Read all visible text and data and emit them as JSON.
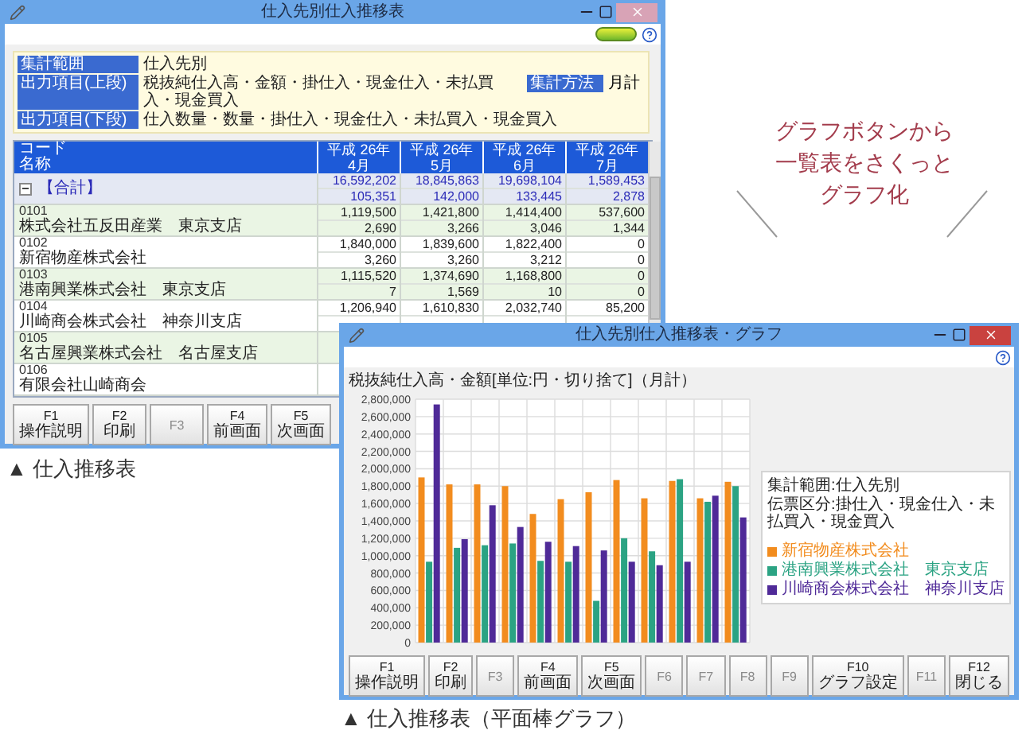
{
  "table_window": {
    "title": "仕入先別仕入推移表",
    "summary": [
      {
        "label": "集計範囲",
        "value": "仕入先別"
      },
      {
        "label": "出力項目(上段)",
        "value": "税抜純仕入高・金額・掛仕入・現金仕入・未払買入・現金買入",
        "method_label": "集計方法",
        "method_value": "月計"
      },
      {
        "label": "出力項目(下段)",
        "value": "仕入数量・数量・掛仕入・現金仕入・未払買入・現金買入"
      }
    ],
    "table": {
      "code_header": "コード",
      "name_header": "名称",
      "columns": [
        {
          "year": "平成 26年",
          "month": "4月"
        },
        {
          "year": "平成 26年",
          "month": "5月"
        },
        {
          "year": "平成 26年",
          "month": "6月"
        },
        {
          "year": "平成 26年",
          "month": "7月"
        }
      ],
      "rows": [
        {
          "kind": "total",
          "expanded": true,
          "name": "【合計】",
          "amounts": [
            "16,592,202",
            "18,845,863",
            "19,698,104",
            "1,589,453"
          ],
          "quantities": [
            "105,351",
            "142,000",
            "133,445",
            "2,878"
          ]
        },
        {
          "kind": "company",
          "code": "0101",
          "name": "株式会社五反田産業　東京支店",
          "amounts": [
            "1,119,500",
            "1,421,800",
            "1,414,400",
            "537,600"
          ],
          "quantities": [
            "2,690",
            "3,266",
            "3,046",
            "1,344"
          ]
        },
        {
          "kind": "company",
          "code": "0102",
          "name": "新宿物産株式会社",
          "amounts": [
            "1,840,000",
            "1,839,600",
            "1,822,400",
            "0"
          ],
          "quantities": [
            "3,260",
            "3,260",
            "3,212",
            "0"
          ]
        },
        {
          "kind": "company",
          "code": "0103",
          "name": "港南興業株式会社　東京支店",
          "amounts": [
            "1,115,520",
            "1,374,690",
            "1,168,800",
            "0"
          ],
          "quantities": [
            "7",
            "1,569",
            "10",
            "0"
          ]
        },
        {
          "kind": "company",
          "code": "0104",
          "name": "川崎商会株式会社　神奈川支店",
          "amounts": [
            "1,206,940",
            "1,610,830",
            "2,032,740",
            "85,200"
          ]
        },
        {
          "kind": "company",
          "code": "0105",
          "name": "名古屋興業株式会社　名古屋支店"
        },
        {
          "kind": "company",
          "code": "0106",
          "name": "有限会社山崎商会"
        }
      ]
    },
    "function_keys": [
      {
        "key": "F1",
        "label": "操作説明",
        "disabled": false
      },
      {
        "key": "F2",
        "label": "印刷",
        "disabled": false
      },
      {
        "key": "F3",
        "disabled": true
      },
      {
        "key": "F4",
        "label": "前画面",
        "disabled": false
      },
      {
        "key": "F5",
        "label": "次画面",
        "disabled": false
      }
    ],
    "caption": "▲ 仕入推移表"
  },
  "graph_window": {
    "title": "仕入先別仕入推移表・グラフ",
    "chart_data": {
      "type": "bar",
      "grid": true,
      "title": "税抜純仕入高・金額[単位:円・切り捨て]（月計）",
      "ylim": [
        0,
        2800000
      ],
      "yticks": [
        {
          "value": 0,
          "label": "0"
        },
        {
          "value": 200000,
          "label": "200,000"
        },
        {
          "value": 400000,
          "label": "400,000"
        },
        {
          "value": 600000,
          "label": "600,000"
        },
        {
          "value": 800000,
          "label": "800,000"
        },
        {
          "value": 1000000,
          "label": "1,000,000"
        },
        {
          "value": 1200000,
          "label": "1,200,000"
        },
        {
          "value": 1400000,
          "label": "1,400,000"
        },
        {
          "value": 1600000,
          "label": "1,600,000"
        },
        {
          "value": 1800000,
          "label": "1,800,000"
        },
        {
          "value": 2000000,
          "label": "2,000,000"
        },
        {
          "value": 2200000,
          "label": "2,200,000"
        },
        {
          "value": 2400000,
          "label": "2,400,000"
        },
        {
          "value": 2600000,
          "label": "2,600,000"
        },
        {
          "value": 2800000,
          "label": "2,800,000"
        }
      ],
      "series": [
        {
          "name": "新宿物産株式会社",
          "color": "#f28c1e",
          "values": [
            1900000,
            1820000,
            1820000,
            1800000,
            1480000,
            1650000,
            1730000,
            1870000,
            1660000,
            1860000,
            1660000,
            1850000
          ]
        },
        {
          "name": "港南興業株式会社　東京支店",
          "color": "#2ba383",
          "values": [
            930000,
            1090000,
            1120000,
            1140000,
            940000,
            930000,
            480000,
            1200000,
            1050000,
            1880000,
            1620000,
            1800000
          ]
        },
        {
          "name": "川崎商会株式会社　神奈川支店",
          "color": "#4f2a98",
          "values": [
            2740000,
            1190000,
            1580000,
            1330000,
            1160000,
            1110000,
            1060000,
            930000,
            890000,
            930000,
            1690000,
            1440000
          ]
        }
      ]
    },
    "legend_lines": [
      "集計範囲:仕入先別",
      "伝票区分:掛仕入・現金仕入・未払買入・現金買入"
    ],
    "function_keys": [
      {
        "key": "F1",
        "label": "操作説明",
        "disabled": false
      },
      {
        "key": "F2",
        "label": "印刷",
        "disabled": false
      },
      {
        "key": "F3",
        "disabled": true
      },
      {
        "key": "F4",
        "label": "前画面",
        "disabled": false
      },
      {
        "key": "F5",
        "label": "次画面",
        "disabled": false
      },
      {
        "key": "F6",
        "disabled": true
      },
      {
        "key": "F7",
        "disabled": true
      },
      {
        "key": "F8",
        "disabled": true
      },
      {
        "key": "F9",
        "disabled": true
      },
      {
        "key": "F10",
        "label": "グラフ設定",
        "disabled": false
      },
      {
        "key": "F11",
        "disabled": true
      },
      {
        "key": "F12",
        "label": "閉じる",
        "disabled": false
      }
    ],
    "caption": "▲ 仕入推移表（平面棒グラフ）"
  },
  "callout": {
    "lines": [
      "グラフボタンから",
      "一覧表をさくっと",
      "グラフ化"
    ]
  }
}
